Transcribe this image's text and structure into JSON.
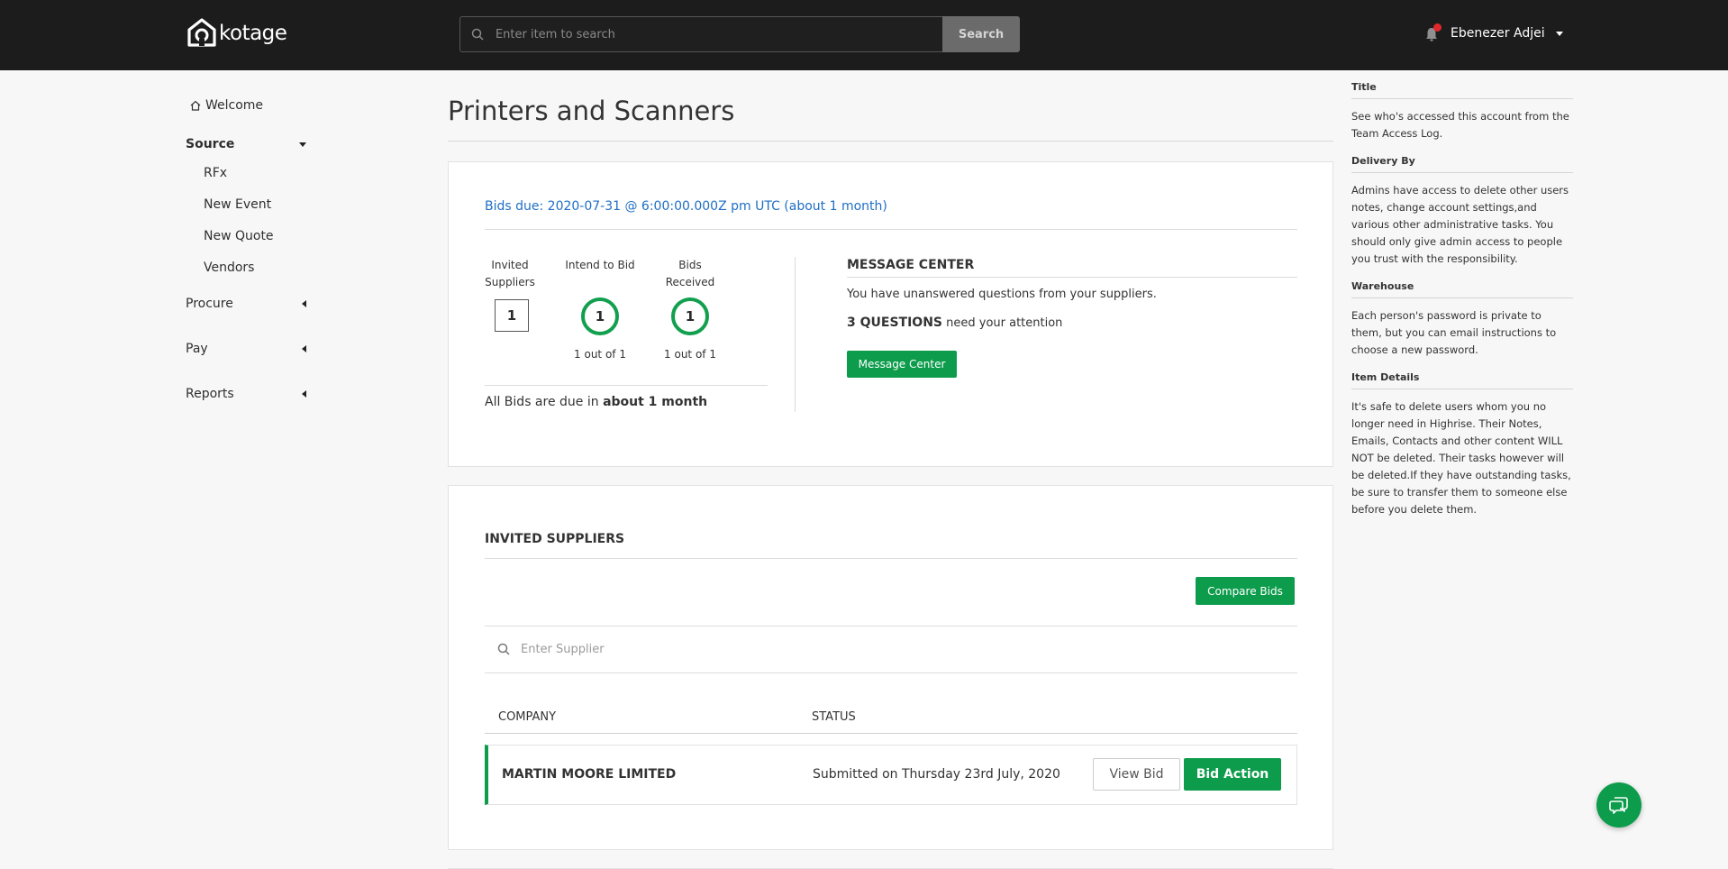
{
  "app": {
    "brand": "kotage"
  },
  "header": {
    "search_placeholder": "Enter item to search",
    "search_button": "Search",
    "user_name": "Ebenezer Adjei"
  },
  "sidebar": {
    "welcome": "Welcome",
    "source": "Source",
    "source_items": [
      "RFx",
      "New Event",
      "New Quote",
      "Vendors"
    ],
    "procure": "Procure",
    "pay": "Pay",
    "reports": "Reports"
  },
  "page": {
    "title": "Printers and Scanners"
  },
  "summary": {
    "bids_due": "Bids due:  2020-07-31  @  6:00:00.000Z pm UTC (about 1 month)",
    "stats": [
      {
        "label": "Invited Suppliers",
        "value": "1",
        "sub": ""
      },
      {
        "label": "Intend to Bid",
        "value": "1",
        "sub": "1 out of 1"
      },
      {
        "label": "Bids Received",
        "value": "1",
        "sub": "1 out of 1"
      }
    ],
    "all_bids_prefix": "All Bids are due in ",
    "all_bids_bold": "about 1 month",
    "message_center": {
      "title": "MESSAGE CENTER",
      "text": "You have unanswered questions from your suppliers.",
      "questions_bold": "3 QUESTIONS",
      "questions_rest": " need your attention",
      "button": "Message Center"
    }
  },
  "suppliers": {
    "title": "INVITED SUPPLIERS",
    "compare_button": "Compare Bids",
    "search_placeholder": "Enter Supplier",
    "columns": {
      "company": "COMPANY",
      "status": "STATUS"
    },
    "rows": [
      {
        "company": "MARTIN MOORE LIMITED",
        "status": "Submitted on  Thursday 23rd July, 2020",
        "view_button": "View Bid",
        "action_button": "Bid Action"
      }
    ]
  },
  "right_panel": [
    {
      "heading": "Title",
      "body": "See who's accessed this account from the Team Access Log."
    },
    {
      "heading": "Delivery By",
      "body": "Admins have access to delete other users notes, change account settings,and various other administrative tasks. You should only give admin access to people you trust with the responsibility."
    },
    {
      "heading": "Warehouse",
      "body": "Each person's password is private to them, but you can email instructions to choose a new password."
    },
    {
      "heading": "Item Details",
      "body": "It's safe to delete users whom you no longer need in Highrise. Their Notes, Emails, Contacts and other content WILL NOT be deleted. Their tasks however will be deleted.If they have outstanding tasks, be sure to transfer them to someone else before you delete them."
    }
  ],
  "colors": {
    "accent": "#0d9c4c",
    "link": "#1f6fc5",
    "topbar": "#1c1c1c"
  }
}
